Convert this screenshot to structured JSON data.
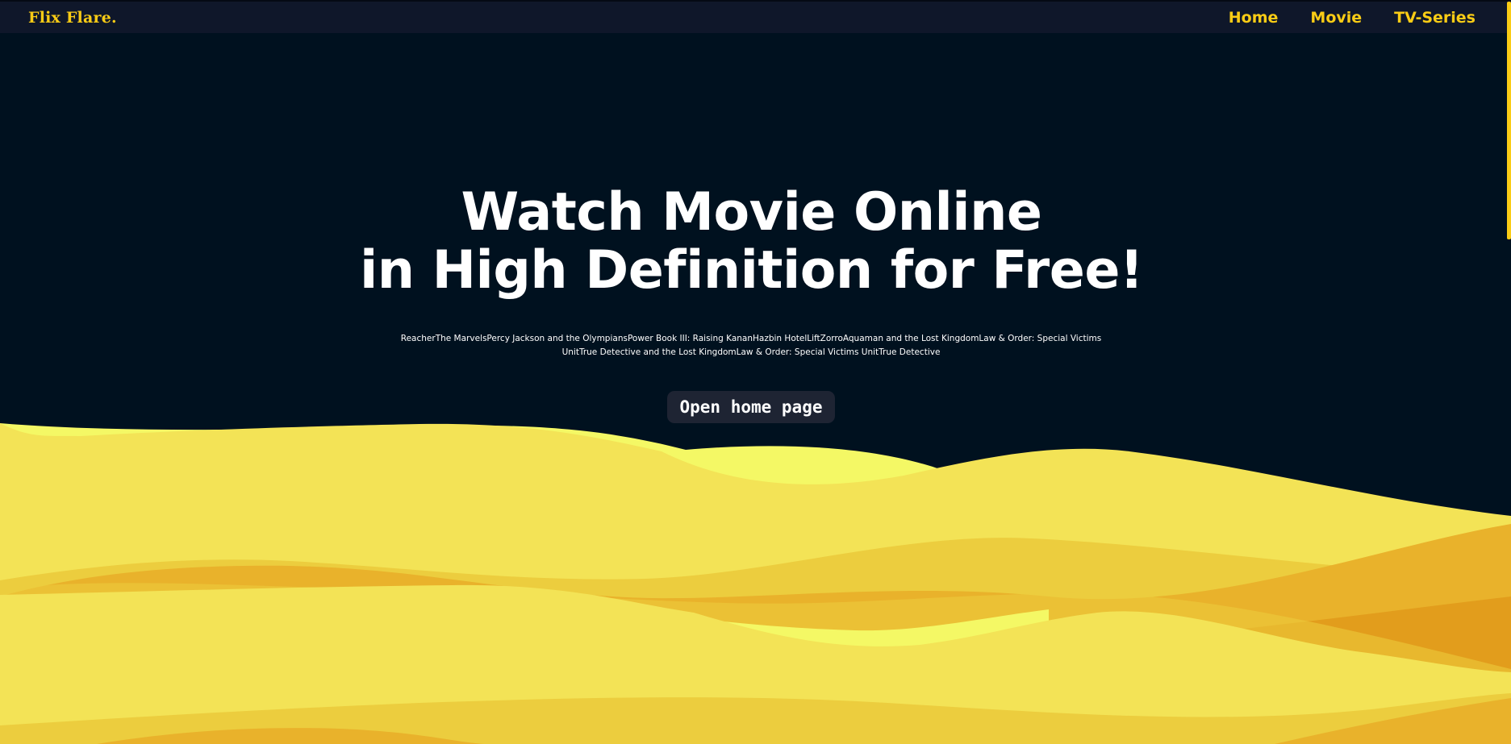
{
  "navbar": {
    "brand": "Flix Flare.",
    "links": [
      {
        "label": "Home"
      },
      {
        "label": "Movie"
      },
      {
        "label": "TV-Series"
      }
    ]
  },
  "hero": {
    "title_line1": "Watch Movie Online",
    "title_line2": "in High Definition for Free!",
    "ticker": "ReacherThe MarvelsPercy Jackson and the OlympiansPower Book III: Raising KananHazbin HotelLiftZorroAquaman and the Lost KingdomLaw & Order: Special Victims UnitTrue Detective and the Lost KingdomLaw & Order: Special Victims UnitTrue Detective",
    "cta_label": "Open home page"
  },
  "colors": {
    "background": "#00111f",
    "navbar": "#0f172a",
    "accent": "#facc15",
    "wave_light": "#f3e356",
    "wave_bright": "#f4f865",
    "wave_mid": "#eccd3e",
    "wave_dark": "#e9b22b",
    "wave_deep": "#e29d1c"
  }
}
